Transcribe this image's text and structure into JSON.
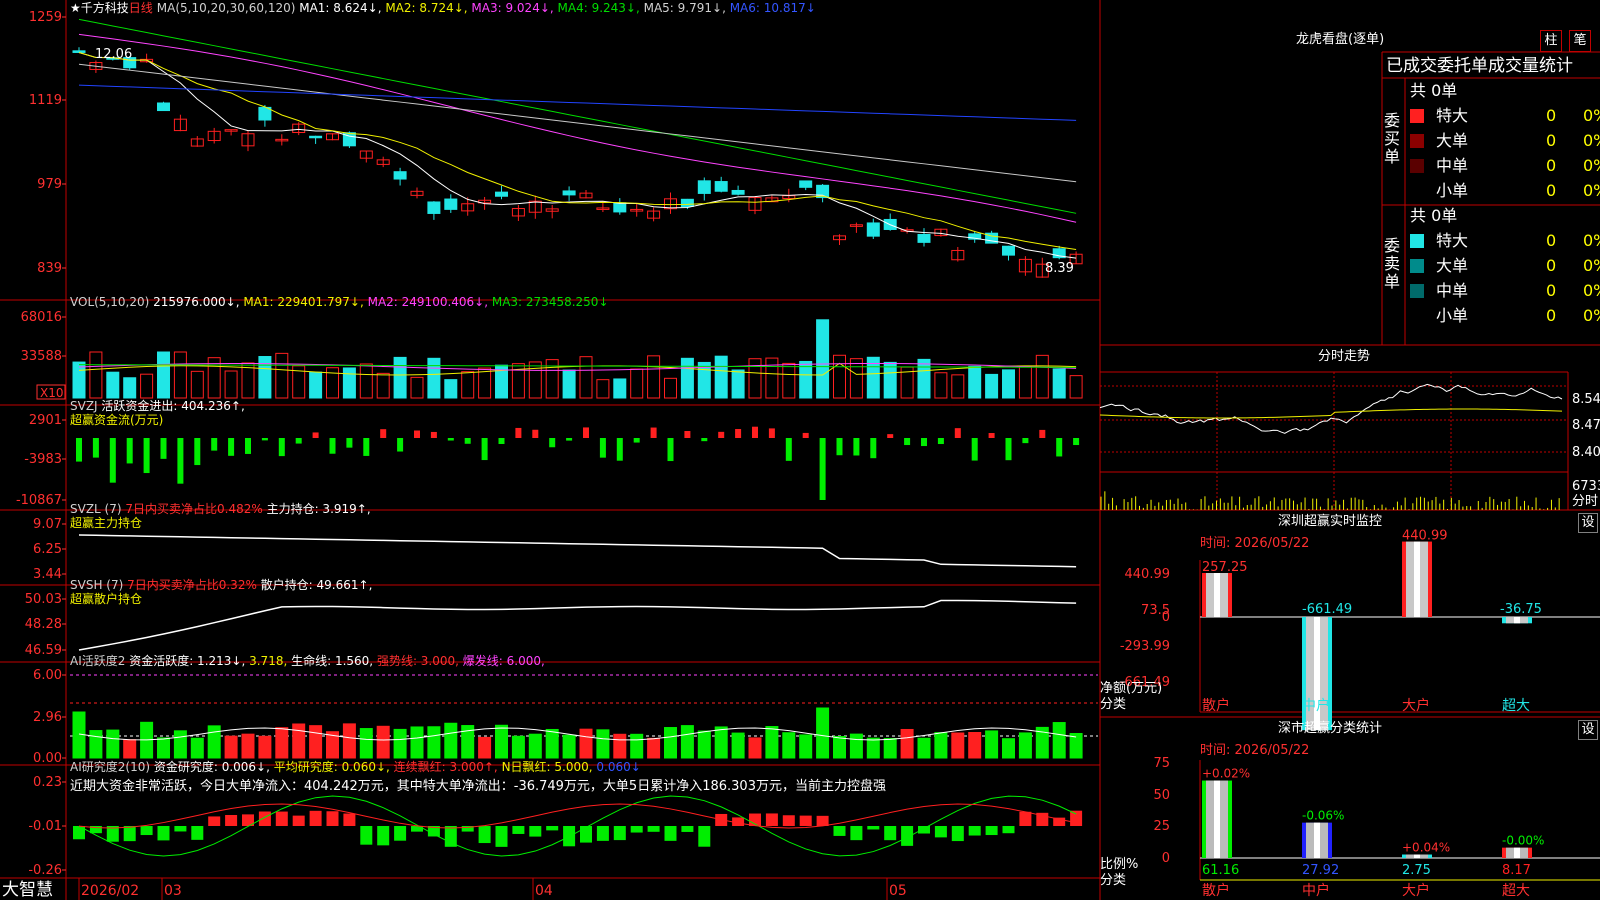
{
  "stock": {
    "name": "千方科技",
    "period": "日线"
  },
  "colors": {
    "up": "#ff2020",
    "down": "#21e6e6",
    "ma1": "#ffffff",
    "ma2": "#f0f000",
    "ma3": "#ff44ff",
    "ma4": "#00dd00",
    "ma5": "#c8c8c8",
    "ma6": "#2244ff",
    "frame": "#c00000",
    "green": "#00ee00",
    "label_red": "#ff3030"
  },
  "price_panel": {
    "ma_legend": [
      {
        "text": "MA(5,10,20,30,60,120)",
        "color": "#d0d0d0"
      },
      {
        "text": "MA1: 8.624↓,",
        "color": "#ffffff"
      },
      {
        "text": "MA2: 8.724↓,",
        "color": "#f0f000"
      },
      {
        "text": "MA3: 9.024↓,",
        "color": "#ff44ff"
      },
      {
        "text": "MA4: 9.243↓,",
        "color": "#00dd00"
      },
      {
        "text": "MA5: 9.791↓,",
        "color": "#d0d0d0"
      },
      {
        "text": "MA6: 10.817↓",
        "color": "#3355ff"
      }
    ],
    "y_ticks": [
      "1259",
      "1119",
      "979",
      "839"
    ],
    "high_label": "12.06",
    "low_label": "8.39"
  },
  "vol_panel": {
    "legend": [
      {
        "text": "VOL(5,10,20)",
        "color": "#d0d0d0"
      },
      {
        "text": "215976.000↓,",
        "color": "#ffffff"
      },
      {
        "text": "MA1: 229401.797↓,",
        "color": "#f0f000"
      },
      {
        "text": "MA2: 249100.406↓,",
        "color": "#ff44ff"
      },
      {
        "text": "MA3: 273458.250↓",
        "color": "#00dd00"
      }
    ],
    "y_ticks": [
      "68016",
      "33588"
    ],
    "unit": "X10"
  },
  "svzj_panel": {
    "legend": [
      {
        "text": "SVZJ",
        "color": "#d0d0d0"
      },
      {
        "text": "活跃资金进出: 404.236↑,",
        "color": "#ffffff"
      }
    ],
    "sub_label": "超赢资金流(万元)",
    "y_ticks": [
      "2901",
      "-3983",
      "-10867"
    ]
  },
  "svzl_panel": {
    "legend": [
      {
        "text": "SVZL (7)",
        "color": "#d0d0d0"
      },
      {
        "text": "7日内买卖净占比0.482%",
        "color": "#ff3030"
      },
      {
        "text": "主力持仓: 3.919↑,",
        "color": "#ffffff"
      }
    ],
    "sub_label": "超赢主力持仓",
    "y_ticks": [
      "9.07",
      "6.25",
      "3.44"
    ]
  },
  "svsh_panel": {
    "legend": [
      {
        "text": "SVSH (7)",
        "color": "#d0d0d0"
      },
      {
        "text": "7日内买卖净占比0.32%",
        "color": "#ff3030"
      },
      {
        "text": "散户持仓: 49.661↑,",
        "color": "#ffffff"
      }
    ],
    "sub_label": "超赢散户持仓",
    "y_ticks": [
      "50.03",
      "48.28",
      "46.59"
    ]
  },
  "ai2_panel": {
    "legend": [
      {
        "text": "AI活跃度2",
        "color": "#d0d0d0"
      },
      {
        "text": "资金活跃度: 1.213↓,",
        "color": "#ffffff"
      },
      {
        "text": "3.718,",
        "color": "#f0f000"
      },
      {
        "text": "生命线: 1.560,",
        "color": "#ffffff"
      },
      {
        "text": "强势线: 3.000,",
        "color": "#ff3030"
      },
      {
        "text": "爆发线: 6.000,",
        "color": "#ff44ff"
      }
    ],
    "y_ticks": [
      "6.00",
      "2.96",
      "0.00"
    ]
  },
  "ai_research_panel": {
    "legend": [
      {
        "text": "AI研究度2(10)",
        "color": "#d0d0d0"
      },
      {
        "text": "资金研究度: 0.006↓,",
        "color": "#ffffff"
      },
      {
        "text": "平均研究度: 0.060↓,",
        "color": "#f0f000"
      },
      {
        "text": "连续飘红: 3.000↑,",
        "color": "#ff3030"
      },
      {
        "text": "N日飘红: 5.000,",
        "color": "#f0f000"
      },
      {
        "text": "0.060↓",
        "color": "#3355ff"
      }
    ],
    "comment": "近期大资金非常活跃，今日大单净流入：404.242万元，其中特大单净流出：-36.749万元，大单5日累计净入186.303万元，当前主力控盘强",
    "y_ticks": [
      "0.23",
      "-0.01",
      "-0.26"
    ]
  },
  "date_axis": [
    "2026/02",
    "03",
    "04",
    "05"
  ],
  "brand": "大智慧",
  "longhu": {
    "title": "龙虎看盘(逐单)",
    "tab_zhu": "柱",
    "tab_bi": "笔",
    "header": "已成交委托单成交量统计",
    "buy_side": "委买单",
    "sell_side": "委卖单",
    "buy_total": "共 0单",
    "sell_total": "共 0单",
    "buy_rows": [
      {
        "label": "特大",
        "count": "0",
        "pct": "0%",
        "color": "#ff2020"
      },
      {
        "label": "大单",
        "count": "0",
        "pct": "0%",
        "color": "#8b0000"
      },
      {
        "label": "中单",
        "count": "0",
        "pct": "0%",
        "color": "#5a0000"
      },
      {
        "label": "小单",
        "count": "0",
        "pct": "0%",
        "color": ""
      }
    ],
    "sell_rows": [
      {
        "label": "特大",
        "count": "0",
        "pct": "0%",
        "color": "#21e6e6"
      },
      {
        "label": "大单",
        "count": "0",
        "pct": "0%",
        "color": "#008b8b"
      },
      {
        "label": "中单",
        "count": "0",
        "pct": "0%",
        "color": "#006a6a"
      },
      {
        "label": "小单",
        "count": "0",
        "pct": "0%",
        "color": ""
      }
    ]
  },
  "intraday": {
    "title": "分时走势",
    "price_ticks": [
      "8.54",
      "8.47",
      "8.40"
    ],
    "vol_tick": "6733",
    "vol_unit": "分时"
  },
  "monitor": {
    "title": "深圳超赢实时监控",
    "set_label": "设",
    "time_label": "时间: 2026/05/22",
    "y_ticks": [
      "440.99",
      "73.5",
      "0",
      "-293.99",
      "-661.49"
    ],
    "ylabel": "净额(万元)",
    "xlabel": "分类",
    "chart_data": {
      "type": "bar",
      "categories": [
        "散户",
        "中户",
        "大户",
        "超大"
      ],
      "values": [
        257.25,
        -661.49,
        440.99,
        -36.75
      ],
      "ylim": [
        -661.49,
        440.99
      ]
    }
  },
  "classify": {
    "title": "深市超赢分类统计",
    "set_label": "设",
    "time_label": "时间: 2026/05/22",
    "y_ticks": [
      "75",
      "50",
      "25",
      "0"
    ],
    "ylabel": "比例%",
    "xlabel": "分类",
    "chart_data": {
      "type": "bar",
      "categories": [
        "散户",
        "中户",
        "大户",
        "超大"
      ],
      "values": [
        61.16,
        27.92,
        2.75,
        8.17
      ],
      "changes": [
        "+0.02%",
        "-0.06%",
        "+0.04%",
        "-0.00%"
      ],
      "ylim": [
        0,
        75
      ]
    }
  }
}
